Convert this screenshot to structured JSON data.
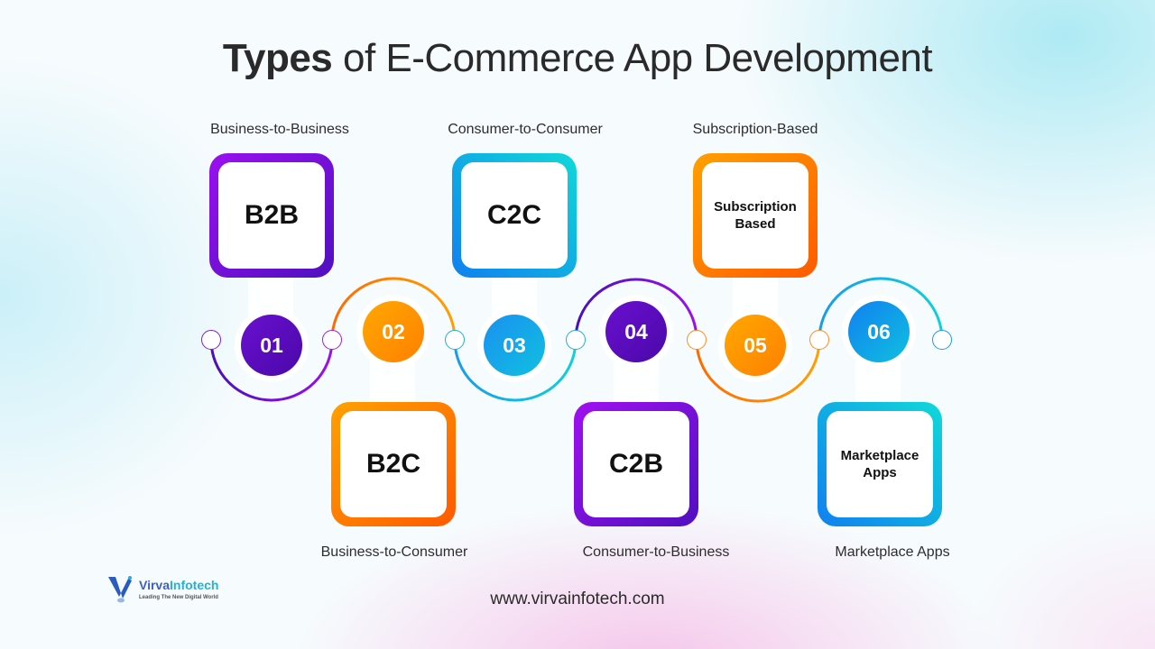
{
  "title": {
    "bold": "Types",
    "rest": " of E-Commerce App Development"
  },
  "colors": {
    "purple": "#6a0fd0",
    "orange": "#ff8c00",
    "blue": "#1a9be8",
    "cyan": "#10d0d8"
  },
  "items": [
    {
      "number": "01",
      "card_text": "B2B",
      "caption": "Business-to-Business",
      "theme": "purple",
      "position": "top"
    },
    {
      "number": "02",
      "card_text": "B2C",
      "caption": "Business-to-Consumer",
      "theme": "orange",
      "position": "bottom"
    },
    {
      "number": "03",
      "card_text": "C2C",
      "caption": "Consumer-to-Consumer",
      "theme": "blue",
      "position": "top"
    },
    {
      "number": "04",
      "card_text": "C2B",
      "caption": "Consumer-to-Business",
      "theme": "purple",
      "position": "bottom"
    },
    {
      "number": "05",
      "card_text": "Subscription Based",
      "caption": "Subscription-Based",
      "theme": "orange",
      "position": "top"
    },
    {
      "number": "06",
      "card_text": "Marketplace Apps",
      "caption": "Marketplace Apps",
      "theme": "blue",
      "position": "bottom"
    }
  ],
  "footer": {
    "logo_brand_main": "Virva",
    "logo_brand_tail": "Infotech",
    "logo_tagline": "Leading The New Digital World",
    "url": "www.virvainfotech.com"
  }
}
